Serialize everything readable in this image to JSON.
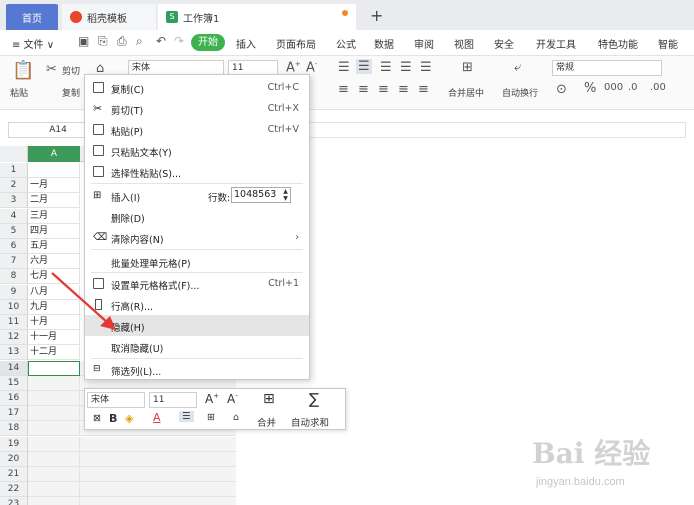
{
  "tabs": {
    "home": "首页",
    "templates": "稻壳模板",
    "workbook": "工作簿1",
    "new_tab": "+"
  },
  "menubar": {
    "file": "≡ 文件 ∨",
    "start": "开始",
    "items": [
      "插入",
      "页面布局",
      "公式",
      "数据",
      "审阅",
      "视图",
      "安全",
      "开发工具",
      "特色功能",
      "智能"
    ]
  },
  "ribbon": {
    "paste": "粘贴",
    "cut": "剪切",
    "copy": "复制",
    "font_name": "宋体",
    "font_size": "11",
    "merge_center": "合并居中",
    "wrap_text": "自动换行",
    "number_format": "常规"
  },
  "formula": {
    "namebox": "A14"
  },
  "grid": {
    "column_a": "A",
    "row_numbers": [
      "1",
      "2",
      "3",
      "4",
      "5",
      "6",
      "7",
      "8",
      "9",
      "10",
      "11",
      "12",
      "13",
      "14",
      "15",
      "16",
      "17",
      "18",
      "19",
      "20",
      "21",
      "22",
      "23"
    ],
    "cells_a": [
      "",
      "一月",
      "二月",
      "三月",
      "四月",
      "五月",
      "六月",
      "七月",
      "八月",
      "九月",
      "十月",
      "十一月",
      "十二月"
    ]
  },
  "context_menu": {
    "copy": {
      "label": "复制(C)",
      "shortcut": "Ctrl+C"
    },
    "cut": {
      "label": "剪切(T)",
      "shortcut": "Ctrl+X"
    },
    "paste": {
      "label": "粘贴(P)",
      "shortcut": "Ctrl+V"
    },
    "paste_text": {
      "label": "只粘贴文本(Y)"
    },
    "paste_special": {
      "label": "选择性粘贴(S)..."
    },
    "insert": {
      "label": "插入(I)",
      "rows_label": "行数:",
      "rows_value": "1048563"
    },
    "delete": {
      "label": "删除(D)"
    },
    "clear": {
      "label": "清除内容(N)",
      "submenu": "›"
    },
    "batch": {
      "label": "批量处理单元格(P)"
    },
    "format_cells": {
      "label": "设置单元格格式(F)...",
      "shortcut": "Ctrl+1"
    },
    "row_height": {
      "label": "行高(R)..."
    },
    "hide": {
      "label": "隐藏(H)"
    },
    "unhide": {
      "label": "取消隐藏(U)"
    },
    "filter_column": {
      "label": "筛选列(L)..."
    }
  },
  "mini_toolbar": {
    "font_name": "宋体",
    "font_size": "11",
    "bold": "B",
    "font_color": "A",
    "merge": "合并",
    "autosum": "自动求和"
  },
  "watermark": {
    "logo": "Bai 经验",
    "url": "jingyan.baidu.com"
  },
  "colors": {
    "accent_green": "#3fb24f",
    "home_tab": "#5677d2",
    "arrow_red": "#e53935"
  }
}
